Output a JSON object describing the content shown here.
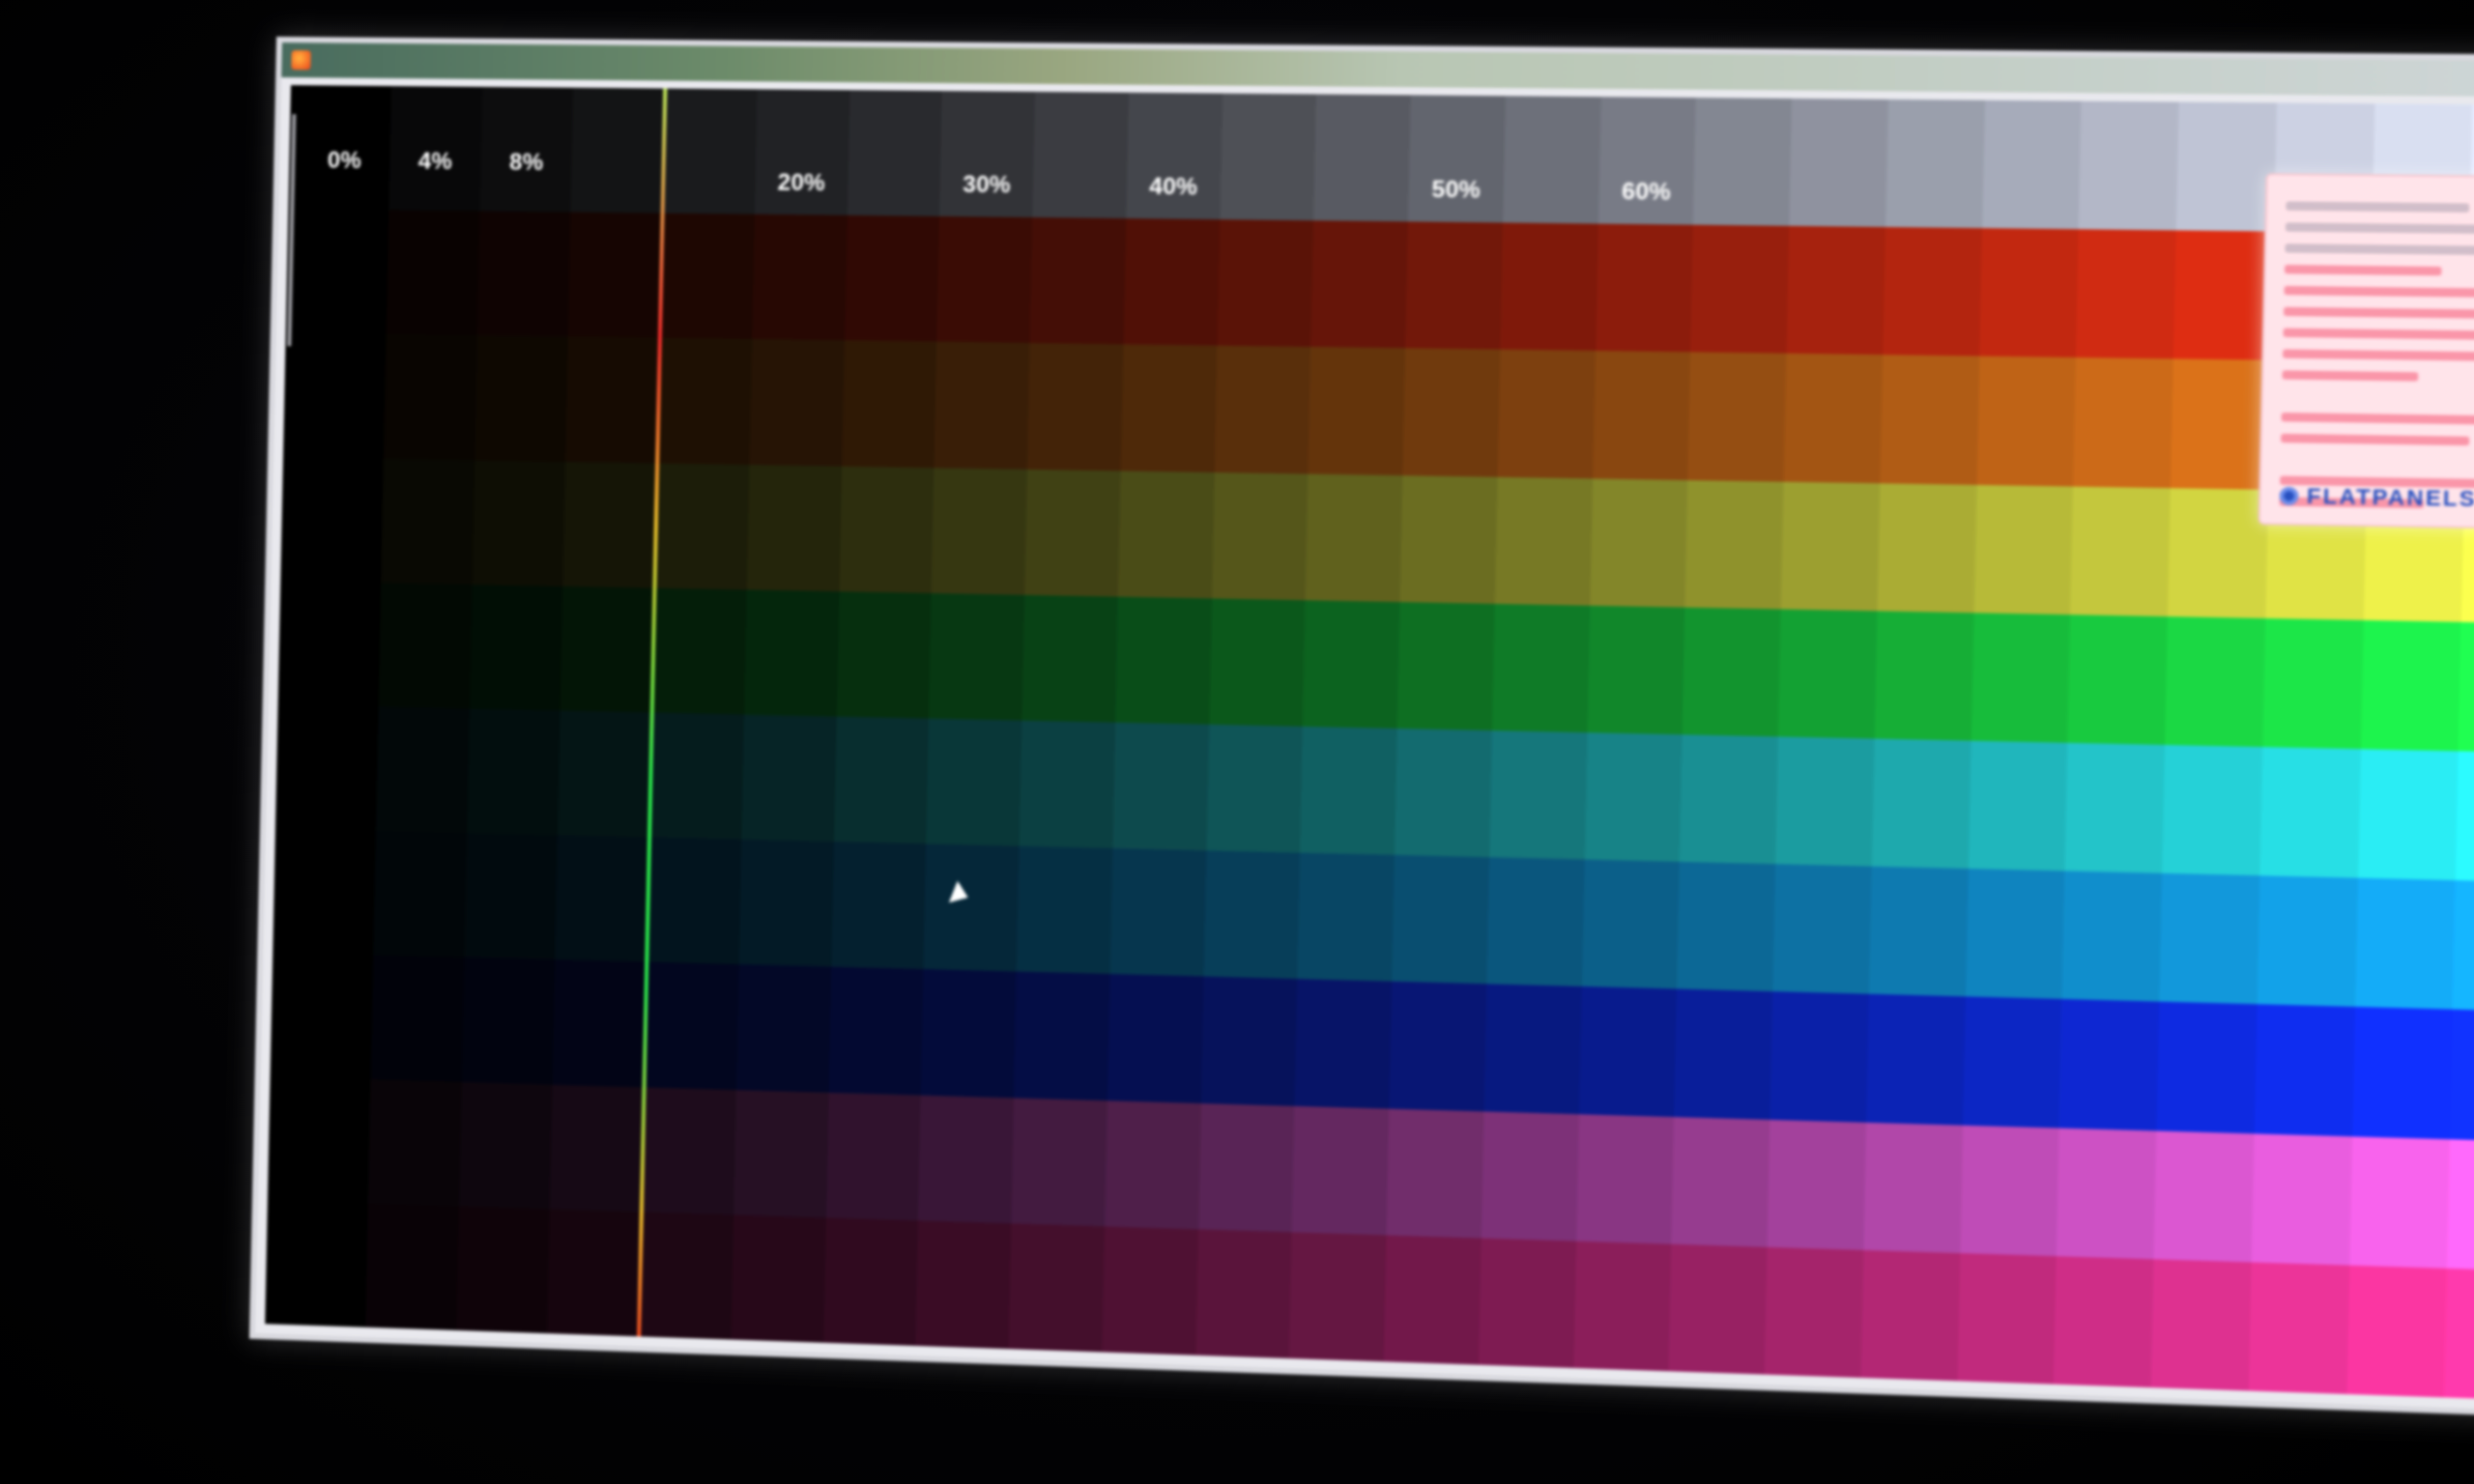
{
  "window": {
    "title": "",
    "icon": "firefox-app-icon"
  },
  "test_grid": {
    "columns": 24,
    "percent_labels": [
      {
        "label": "0%",
        "column": 0
      },
      {
        "label": "4%",
        "column": 1
      },
      {
        "label": "8%",
        "column": 2
      },
      {
        "label": "20%",
        "column": 5
      },
      {
        "label": "30%",
        "column": 7
      },
      {
        "label": "40%",
        "column": 9
      },
      {
        "label": "50%",
        "column": 12
      },
      {
        "label": "60%",
        "column": 14
      }
    ],
    "rows": [
      {
        "name": "gray",
        "color": "#e6ecff"
      },
      {
        "name": "red",
        "color": "#ff3a1c"
      },
      {
        "name": "orange",
        "color": "#ff8a28"
      },
      {
        "name": "yellow",
        "color": "#fbff5a"
      },
      {
        "name": "green",
        "color": "#2cff5a"
      },
      {
        "name": "cyan",
        "color": "#38f8ff"
      },
      {
        "name": "azure",
        "color": "#1fb4ff"
      },
      {
        "name": "blue",
        "color": "#1434ff"
      },
      {
        "name": "violet",
        "color": "#ff6cf4"
      },
      {
        "name": "magenta",
        "color": "#ff3ea8"
      }
    ],
    "marker_column": 4
  },
  "info_panel": {
    "logo_text": "FLATPANELSDK",
    "background": "#ffe4ea"
  },
  "cursor": {
    "icon": "arrow-cursor-icon"
  }
}
